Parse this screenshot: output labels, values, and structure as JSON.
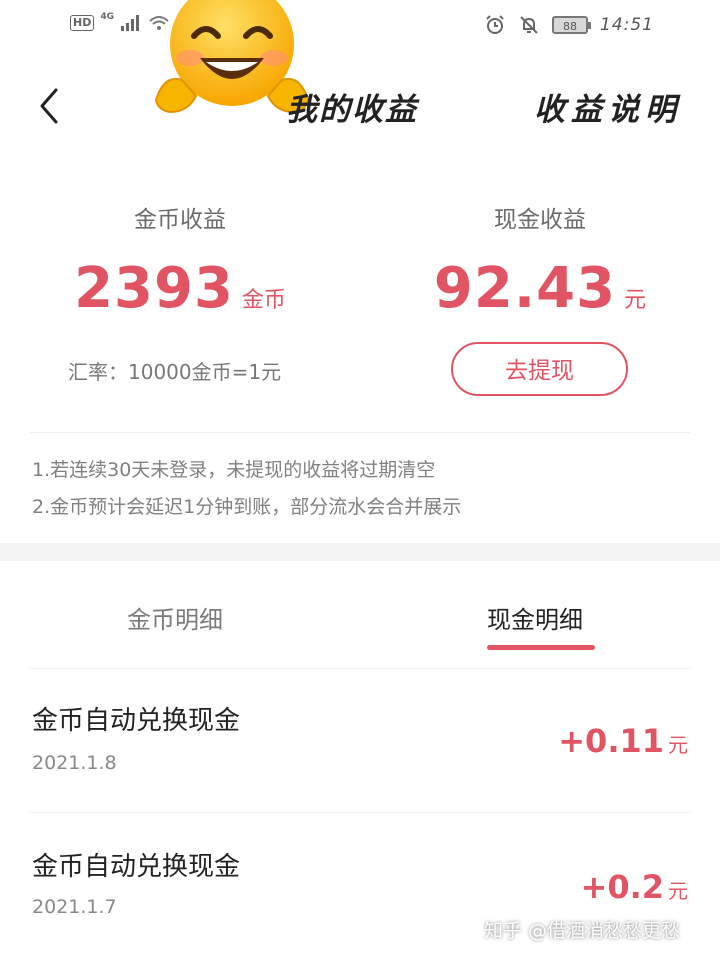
{
  "status_bar": {
    "hd_badge": "HD",
    "signal_text": "4G",
    "battery": "88",
    "time": "14:51"
  },
  "nav": {
    "title": "我的收益",
    "right_link": "收益说明"
  },
  "earnings": {
    "coins": {
      "label": "金币收益",
      "value": "2393",
      "unit": "金币"
    },
    "cash": {
      "label": "现金收益",
      "value": "92.43",
      "unit": "元"
    },
    "rate": "汇率：10000金币=1元",
    "withdraw_button": "去提现"
  },
  "notices": [
    "1.若连续30天未登录，未提现的收益将过期清空",
    "2.金币预计会延迟1分钟到账，部分流水会合并展示"
  ],
  "tabs": [
    {
      "label": "金币明细",
      "active": false
    },
    {
      "label": "现金明细",
      "active": true
    }
  ],
  "records": [
    {
      "title": "金币自动兑换现金",
      "date": "2021.1.8",
      "amount": "+0.11",
      "unit": "元"
    },
    {
      "title": "金币自动兑换现金",
      "date": "2021.1.7",
      "amount": "+0.2",
      "unit": "元"
    }
  ],
  "watermark": "知乎 @借酒消愁愁更愁",
  "colors": {
    "accent": "#e15463",
    "section_bg": "#f3f3f3"
  }
}
